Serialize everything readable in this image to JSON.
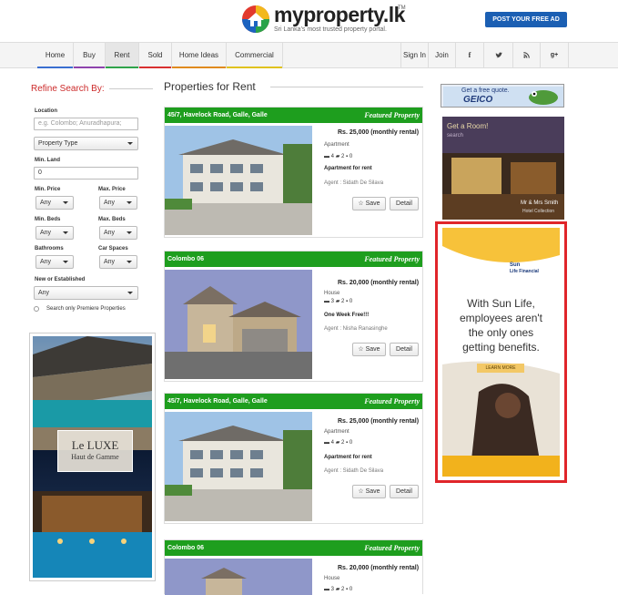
{
  "header": {
    "logo_text": "myproperty.lk",
    "logo_tm": "TM",
    "tagline": "Sri Lanka's most trusted property portal.",
    "post_button": "POST YOUR FREE AD",
    "brand_color": "#1b5fb3"
  },
  "nav": {
    "items": [
      {
        "label": "Home",
        "bar": "#3a6fd0"
      },
      {
        "label": "Buy",
        "bar": "#8e44ad"
      },
      {
        "label": "Rent",
        "bar": "#2fa34a"
      },
      {
        "label": "Sold",
        "bar": "#d83030"
      },
      {
        "label": "Home Ideas",
        "bar": "#e08a1e"
      },
      {
        "label": "Commercial",
        "bar": "#e0c21e"
      }
    ],
    "sign_in": "Sign In",
    "join": "Join",
    "social_icons": [
      "facebook-icon",
      "twitter-icon",
      "rss-icon",
      "google-plus-icon"
    ]
  },
  "search": {
    "title": "Refine Search By:",
    "location_label": "Location",
    "location_placeholder": "e.g. Colombo; Anuradhapura;",
    "property_type": "Property Type",
    "min_land_label": "Min. Land",
    "min_land_value": "0",
    "min_price_label": "Min. Price",
    "max_price_label": "Max. Price",
    "min_beds_label": "Min. Beds",
    "max_beds_label": "Max. Beds",
    "bathrooms_label": "Bathrooms",
    "car_spaces_label": "Car Spaces",
    "any": "Any",
    "new_established_label": "New or Established",
    "premiere_label": "Search only Premiere Properties"
  },
  "left_ad": {
    "brand_line1": "Le LUXE",
    "brand_line2": "Haut de Gamme"
  },
  "listings": {
    "title": "Properties for Rent",
    "featured_label": "Featured Property",
    "save_label": "Save",
    "detail_label": "Detail",
    "items": [
      {
        "heading": "45/7, Havelock Road, Galle, Galle",
        "price": "Rs. 25,000 (monthly rental)",
        "type": "Apartment",
        "beds": "4",
        "baths": "2",
        "cars": "0",
        "desc": "Apartment for rent",
        "agent": "Agent : Sidath De Silava"
      },
      {
        "heading": "Colombo 06",
        "price": "Rs. 20,000 (monthly rental)",
        "type": "House",
        "beds": "3",
        "baths": "2",
        "cars": "0",
        "desc": "One Week Free!!!",
        "agent": "Agent : Nisha Ranasinghe"
      },
      {
        "heading": "45/7, Havelock Road, Galle, Galle",
        "price": "Rs. 25,000 (monthly rental)",
        "type": "Apartment",
        "beds": "4",
        "baths": "2",
        "cars": "0",
        "desc": "Apartment for rent",
        "agent": "Agent : Sidath De Silava"
      },
      {
        "heading": "Colombo 06",
        "price": "Rs. 20,000 (monthly rental)",
        "type": "House",
        "beds": "3",
        "baths": "2",
        "cars": "0",
        "desc": "",
        "agent": ""
      }
    ]
  },
  "right_ads": {
    "geico_line1": "Get a free quote.",
    "geico_brand": "GEICO",
    "room_title": "Get a Room!",
    "room_sub": "search",
    "room_hotel": "Mr & Mrs Smith",
    "room_hotel_sub": "Hotel Collection",
    "sunlife_brand1": "Sun",
    "sunlife_brand2": "Life Financial",
    "sunlife_line1": "With Sun Life,",
    "sunlife_line2": "employees aren't",
    "sunlife_line3": "the only ones",
    "sunlife_line4": "getting benefits.",
    "sunlife_cta": "LEARN MORE"
  }
}
